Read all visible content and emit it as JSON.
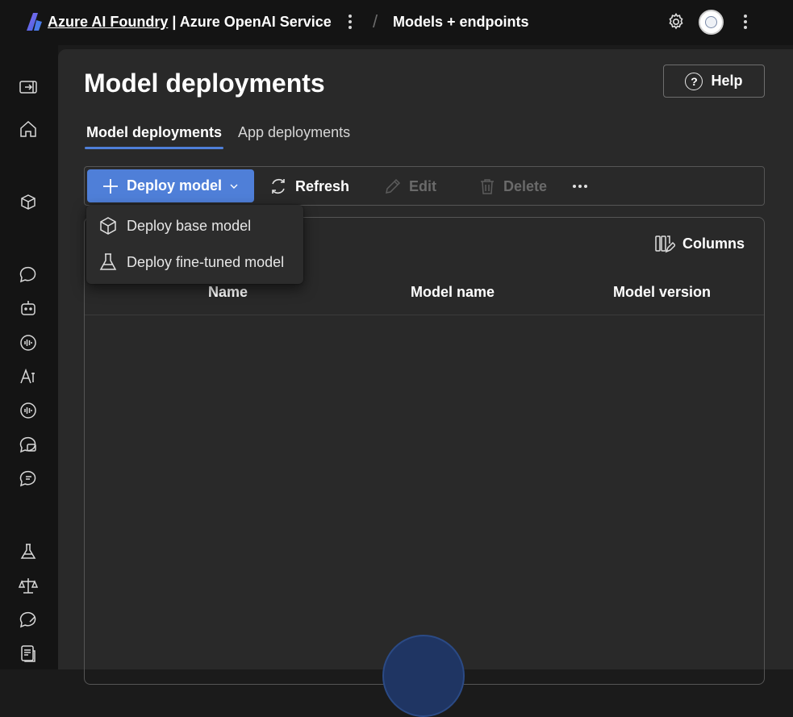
{
  "header": {
    "brand_link": "Azure AI Foundry",
    "brand_separator": "|",
    "brand_service": "Azure OpenAI Service",
    "breadcrumb": "Models + endpoints",
    "breadcrumb_separator": "/"
  },
  "page": {
    "title": "Model deployments",
    "help_label": "Help"
  },
  "tabs": [
    {
      "label": "Model deployments",
      "active": true
    },
    {
      "label": "App deployments",
      "active": false
    }
  ],
  "toolbar": {
    "deploy_label": "Deploy model",
    "refresh_label": "Refresh",
    "edit_label": "Edit",
    "delete_label": "Delete"
  },
  "dropdown": {
    "items": [
      {
        "label": "Deploy base model",
        "icon": "cube-icon"
      },
      {
        "label": "Deploy fine-tuned model",
        "icon": "flask-icon"
      }
    ]
  },
  "table": {
    "columns_label": "Columns",
    "headers": [
      "Name",
      "Model name",
      "Model version"
    ]
  },
  "colors": {
    "accent": "#4f7fd8",
    "background": "#292929",
    "chrome": "#141414"
  },
  "sidebar_icons": [
    "expand-icon",
    "home-icon",
    "model-catalog-icon",
    "chat-icon",
    "assistant-bot-icon",
    "audio-icon",
    "text-to-speech-icon",
    "realtime-audio-icon",
    "image-icon",
    "completions-icon",
    "fine-tuning-icon",
    "safety-icon",
    "feedback-icon",
    "data-files-icon"
  ]
}
